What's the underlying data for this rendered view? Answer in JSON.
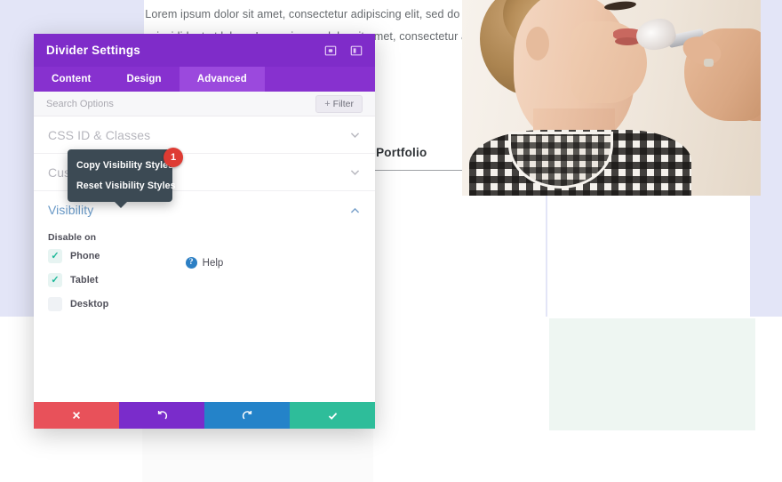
{
  "background": {
    "body_text": "Lorem ipsum dolor sit amet, consectetur adipiscing elit, sed do eiusmod tempor incididunt ut labore Lorem ipsum dolor sit amet, consectetur adipiscing elit,",
    "portfolio_heading": "My Portfolio",
    "photo_alt": "woman-having-makeup-applied-with-brush",
    "colors": {
      "lavender_band": "#e3e5f7",
      "mint_band": "#eef6f2"
    }
  },
  "modal": {
    "title": "Divider Settings",
    "header_icons": [
      {
        "name": "expand-icon"
      },
      {
        "name": "layout-toggle-icon"
      }
    ],
    "tabs": [
      {
        "label": "Content",
        "active": false
      },
      {
        "label": "Design",
        "active": false
      },
      {
        "label": "Advanced",
        "active": true
      }
    ],
    "search": {
      "placeholder": "Search Options",
      "value": ""
    },
    "filter_button": {
      "plus": "+",
      "label": "Filter"
    },
    "accordions": [
      {
        "label": "CSS ID & Classes",
        "open": false,
        "chevron": "chevron-down"
      },
      {
        "label": "Custom CSS",
        "open": false,
        "chevron": "chevron-down"
      }
    ],
    "visibility": {
      "title": "Visibility",
      "chevron": "chevron-up",
      "group_label": "Disable on",
      "options": [
        {
          "label": "Phone",
          "checked": true
        },
        {
          "label": "Tablet",
          "checked": true
        },
        {
          "label": "Desktop",
          "checked": false
        }
      ],
      "check_color": "#1fb99a"
    },
    "help": {
      "icon_char": "?",
      "label": "Help"
    },
    "footer_buttons": [
      {
        "name": "cancel-button",
        "icon": "x-icon",
        "color": "#e8515a"
      },
      {
        "name": "undo-button",
        "icon": "undo-icon",
        "color": "#7a2ccb"
      },
      {
        "name": "redo-button",
        "icon": "redo-icon",
        "color": "#2483c9"
      },
      {
        "name": "save-button",
        "icon": "check-icon",
        "color": "#2ebd9a"
      }
    ],
    "colors": {
      "header": "#7f2cc9",
      "tabbar": "#8731cf",
      "tab_active": "#9b49dd"
    }
  },
  "context_menu": {
    "items": [
      {
        "label": "Copy Visibility Styles"
      },
      {
        "label": "Reset Visibility Styles"
      }
    ],
    "badge": "1",
    "badge_color": "#de3b33",
    "background": "#3c4a54"
  }
}
